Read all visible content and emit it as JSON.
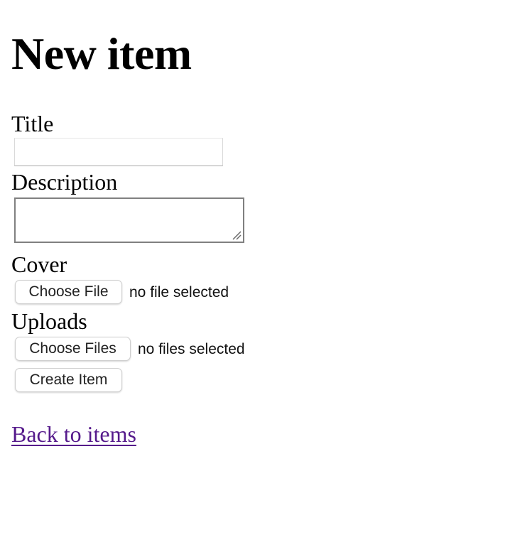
{
  "page": {
    "heading": "New item"
  },
  "form": {
    "title": {
      "label": "Title",
      "value": ""
    },
    "description": {
      "label": "Description",
      "value": ""
    },
    "cover": {
      "label": "Cover",
      "button_label": "Choose File",
      "status": "no file selected"
    },
    "uploads": {
      "label": "Uploads",
      "button_label": "Choose Files",
      "status": "no files selected"
    },
    "submit_label": "Create Item"
  },
  "links": {
    "back_label": "Back to items"
  },
  "colors": {
    "visited_link": "#551a8b",
    "textarea_border": "#808080"
  }
}
